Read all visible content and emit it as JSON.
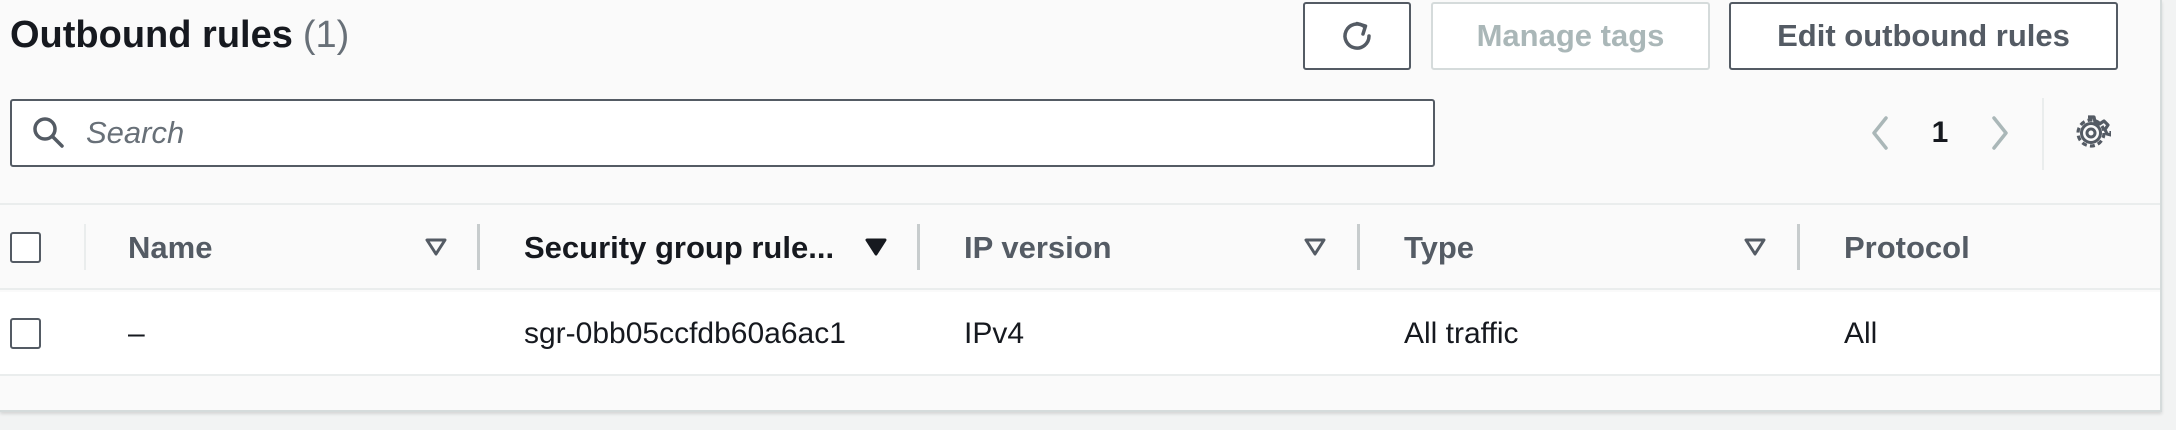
{
  "header": {
    "title": "Outbound rules",
    "count": "(1)"
  },
  "toolbar": {
    "refresh_icon": "refresh-icon",
    "manage_tags_label": "Manage tags",
    "edit_label": "Edit outbound rules"
  },
  "search": {
    "placeholder": "Search",
    "value": "",
    "icon": "search-icon"
  },
  "pagination": {
    "current_page": "1",
    "prev_icon": "chevron-left-icon",
    "next_icon": "chevron-right-icon",
    "settings_icon": "gear-icon"
  },
  "table": {
    "columns": [
      {
        "label": "Name"
      },
      {
        "label": "Security group rule..."
      },
      {
        "label": "IP version"
      },
      {
        "label": "Type"
      },
      {
        "label": "Protocol"
      }
    ],
    "rows": [
      {
        "name": "–",
        "rule_id": "sgr-0bb05ccfdb60a6ac1",
        "ip_version": "IPv4",
        "type": "All traffic",
        "protocol": "All"
      }
    ]
  },
  "colors": {
    "text": "#16191f",
    "secondary": "#545b64",
    "disabled": "#aab7b8",
    "border": "#eaeded"
  }
}
